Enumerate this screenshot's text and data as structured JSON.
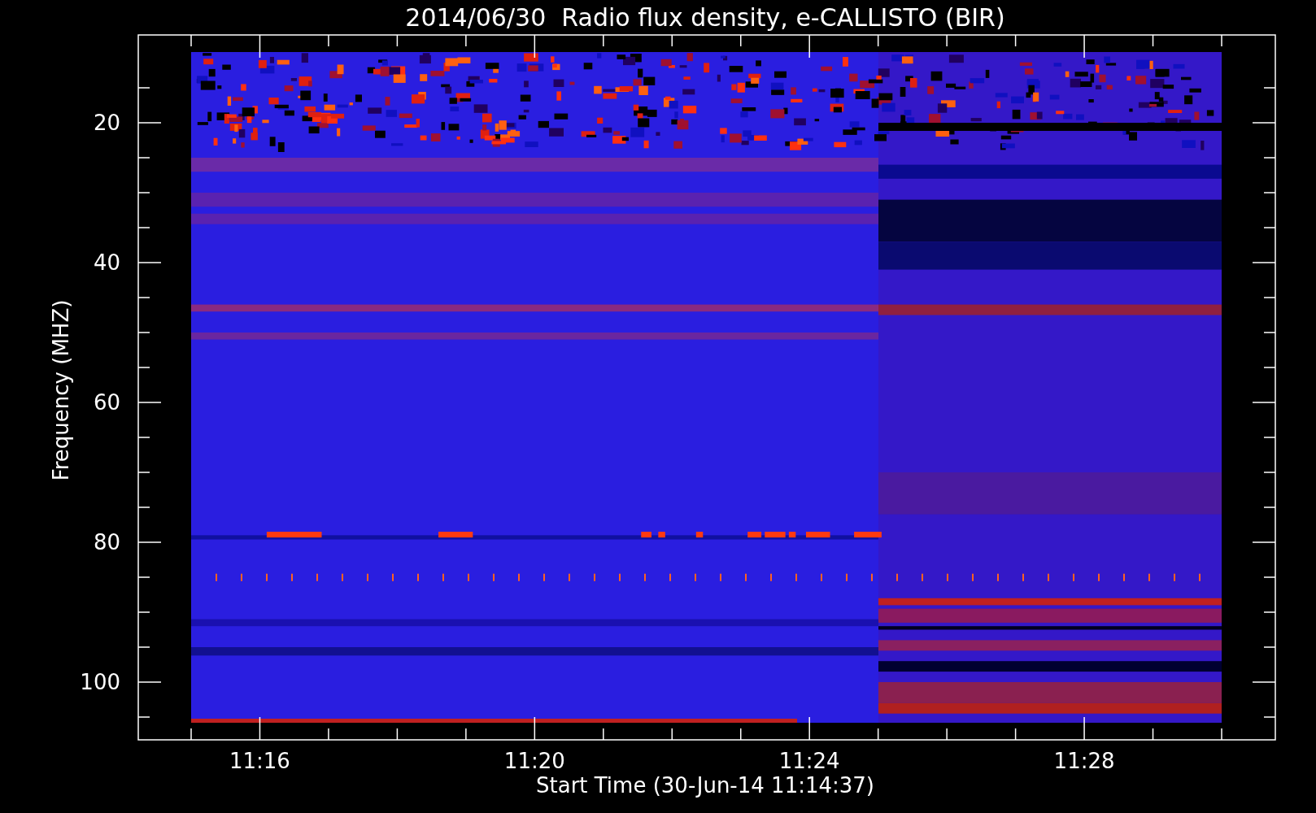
{
  "chart": {
    "title": "2014/06/30  Radio flux density, e-CALLISTO (BIR)",
    "xlabel": "Start Time (30-Jun-14 11:14:37)",
    "ylabel": "Frequency (MHZ)",
    "xticks": [
      "11:16",
      "11:20",
      "11:24",
      "11:28"
    ],
    "yticks": [
      "20",
      "40",
      "60",
      "80",
      "100"
    ]
  }
}
